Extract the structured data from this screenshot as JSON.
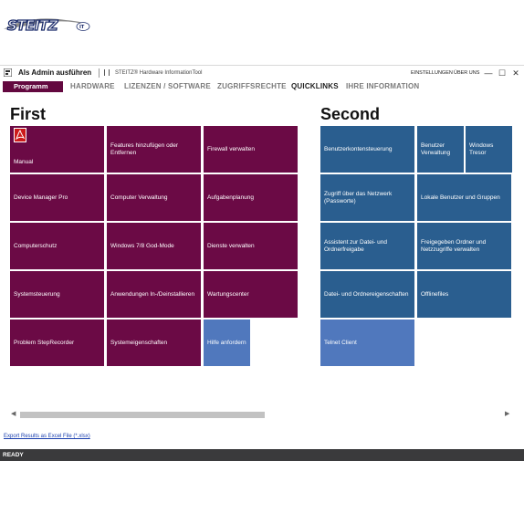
{
  "logo": {
    "text": "STEITZ",
    "badge": "IT"
  },
  "titlebar": {
    "admin_label": "Als Admin ausführen",
    "app_title": "STEITZ® Hardware InformationTool",
    "settings": "EINSTELLUNGEN",
    "about": "ÜBER UNS",
    "minimize": "—",
    "maximize": "☐",
    "close": "✕"
  },
  "menu": {
    "program": "Programm",
    "items": [
      "HARDWARE",
      "LIZENZEN / SOFTWARE",
      "ZUGRIFFSRECHTE",
      "QUICKLINKS",
      "IHRE INFORMATION"
    ]
  },
  "groups": {
    "first": "First",
    "second": "Second"
  },
  "tiles_first": [
    "Manual",
    "Features hinzufügen oder Entfernen",
    "Firewall verwalten",
    "Device Manager Pro",
    "Computer Verwaltung",
    "Aufgabenplanung",
    "Computerschutz",
    "Windows 7/8 God-Mode",
    "Dienste verwalten",
    "Systemsteuerung",
    "Anwendungen In-/Deinstallieren",
    "Wartungscenter",
    "Problem StepRecorder",
    "Systemeigenschaften",
    "Hilfe anfordern"
  ],
  "tiles_second": [
    "Benutzerkontensteuerung",
    "Benutzer Verwaltung",
    "Windows Tresor",
    "Zugriff über das Netzwerk (Passworte)",
    "Lokale Benutzer und Gruppen",
    "Assistent zur Datei- und Ordnerfreigabe",
    "Freigegeben Ordner und Netzzugriffe verwalten",
    "Datei- und Ordnereigenschaften",
    "Offlinefiles",
    "Telnet Client"
  ],
  "scroll": {
    "left": "◀",
    "right": "▶"
  },
  "export_link": "Export Results as Excel File (*.xlsx)",
  "status": "READY",
  "colors": {
    "accent_red": "#6b0a45",
    "accent_blue": "#2a5e8f",
    "accent_light_blue": "#5078bd",
    "statusbar": "#3a3a3c"
  },
  "icons": {
    "pdf": "adobe-pdf-icon",
    "app": "app-icon"
  }
}
